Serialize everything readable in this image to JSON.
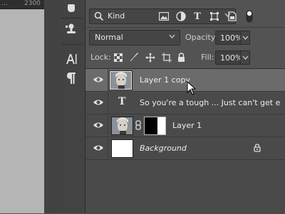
{
  "ruler": {
    "tick_label": "2300"
  },
  "tools": [
    {
      "name": "hand-tool-icon"
    },
    {
      "name": "puppet-stamp-icon"
    },
    {
      "name": "character-panel-icon"
    },
    {
      "name": "paragraph-panel-icon"
    }
  ],
  "layers_panel": {
    "filter": {
      "label": "Kind"
    },
    "filter_icons": [
      "image-filter-icon",
      "adjustment-filter-icon",
      "type-filter-icon",
      "shape-filter-icon",
      "smart-object-filter-icon",
      "filter-toggle-icon"
    ],
    "blend_mode": "Normal",
    "opacity_label": "Opacity:",
    "opacity_value": "100%",
    "lock_label": "Lock:",
    "lock_icons": [
      "lock-transparent-pixels-icon",
      "lock-image-pixels-icon",
      "lock-position-icon",
      "lock-artboard-icon",
      "lock-all-icon"
    ],
    "fill_label": "Fill:",
    "fill_value": "100%",
    "layers": [
      {
        "name": "Layer 1 copy",
        "type": "image",
        "selected": true
      },
      {
        "name": "So you're a tough ... Just can't get e",
        "type": "text",
        "selected": false
      },
      {
        "name": "Layer 1",
        "type": "image-with-mask",
        "selected": false
      },
      {
        "name": "Background",
        "type": "background",
        "selected": false,
        "locked": true
      }
    ]
  },
  "colors": {
    "panel_bg": "#535353",
    "selected_row": "#6b6b6b",
    "canvas_gray": "#b5b5b5"
  }
}
